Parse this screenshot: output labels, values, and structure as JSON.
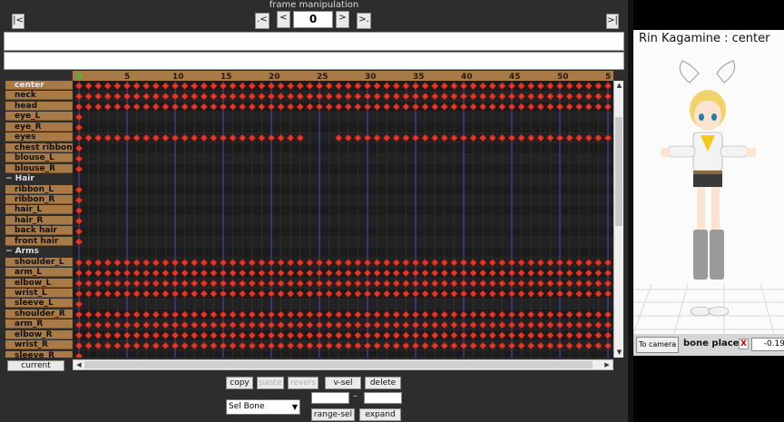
{
  "header": {
    "title": "frame manipulation",
    "frame_value": "0"
  },
  "nav": {
    "first": "|<",
    "last": ">|",
    "prev_key": ".<",
    "prev": "<",
    "next": ">",
    "next_key": ">."
  },
  "ruler": {
    "labels": [
      "0",
      "5",
      "10",
      "15",
      "20",
      "25",
      "30",
      "35",
      "40",
      "45",
      "50",
      "5"
    ]
  },
  "bones": [
    {
      "label": "center",
      "type": "bone",
      "selected": true,
      "keys": "all"
    },
    {
      "label": "neck",
      "type": "bone",
      "keys": "all"
    },
    {
      "label": "head",
      "type": "bone",
      "keys": "all"
    },
    {
      "label": "eye_L",
      "type": "bone",
      "keys": "first"
    },
    {
      "label": "eye_R",
      "type": "bone",
      "keys": "first"
    },
    {
      "label": "eyes",
      "type": "bone",
      "keys": "gap"
    },
    {
      "label": "chest ribbon",
      "type": "bone",
      "keys": "first"
    },
    {
      "label": "blouse_L",
      "type": "bone",
      "keys": "first"
    },
    {
      "label": "blouse_R",
      "type": "bone",
      "keys": "first"
    },
    {
      "label": "− Hair",
      "type": "folder",
      "keys": "none"
    },
    {
      "label": "ribbon_L",
      "type": "bone",
      "keys": "first"
    },
    {
      "label": "ribbon_R",
      "type": "bone",
      "keys": "first"
    },
    {
      "label": "hair_L",
      "type": "bone",
      "keys": "first"
    },
    {
      "label": "hair_R",
      "type": "bone",
      "keys": "first"
    },
    {
      "label": "back hair",
      "type": "bone",
      "keys": "first"
    },
    {
      "label": "front hair",
      "type": "bone",
      "keys": "first"
    },
    {
      "label": "− Arms",
      "type": "folder",
      "keys": "none"
    },
    {
      "label": "shoulder_L",
      "type": "bone",
      "keys": "all"
    },
    {
      "label": "arm_L",
      "type": "bone",
      "keys": "all"
    },
    {
      "label": "elbow_L",
      "type": "bone",
      "keys": "all"
    },
    {
      "label": "wrist_L",
      "type": "bone",
      "keys": "all"
    },
    {
      "label": "sleeve_L",
      "type": "bone",
      "keys": "first"
    },
    {
      "label": "shoulder_R",
      "type": "bone",
      "keys": "all"
    },
    {
      "label": "arm_R",
      "type": "bone",
      "keys": "all"
    },
    {
      "label": "elbow_R",
      "type": "bone",
      "keys": "all"
    },
    {
      "label": "wrist_R",
      "type": "bone",
      "keys": "all"
    },
    {
      "label": "sleeve_R",
      "type": "bone",
      "keys": "first"
    }
  ],
  "bottom": {
    "current": "current",
    "copy": "copy",
    "paste": "paste",
    "revers": "revers",
    "vsel": "v-sel",
    "delete": "delete",
    "sel_bone": "Sel Bone",
    "dash": "–",
    "range_sel": "range-sel",
    "expand": "expand"
  },
  "viewer": {
    "model_name": "Rin Kagamine : center",
    "to_camera": "To camera",
    "bone_place": "bone place",
    "x_label": "X",
    "x_value": "-0.19"
  },
  "colors": {
    "key": "#e0382a",
    "key_stroke": "#7a0f0a",
    "grid_minor": "#3a3a3a",
    "grid_major": "#4a4ac8",
    "ruler_bg": "#a87a48"
  }
}
